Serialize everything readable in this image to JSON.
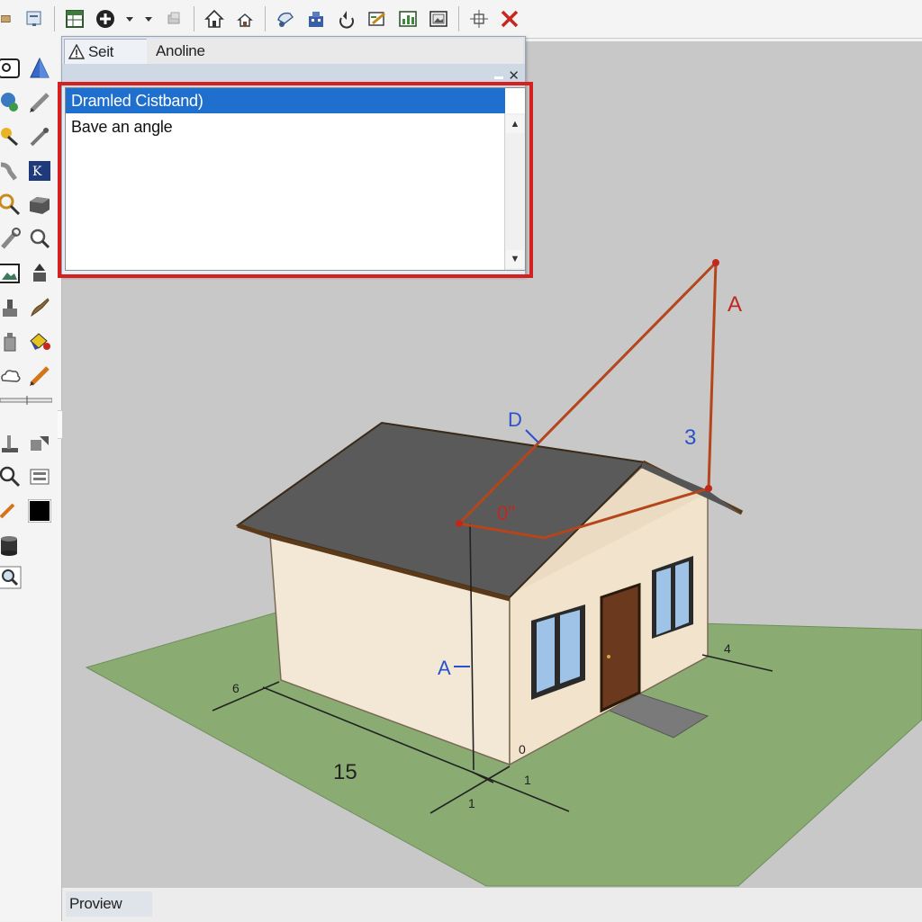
{
  "toolbar": {
    "items": [
      "save-icon",
      "document-icon",
      "table-icon",
      "add-circle-icon",
      "dropdown-arrow-icon",
      "layers-icon",
      "house-icon",
      "house-small-icon",
      "paint-icon",
      "building-icon",
      "rotate-icon",
      "edit-icon",
      "chart-icon",
      "picture-icon",
      "move-icon",
      "close-icon"
    ]
  },
  "palette": {
    "items": [
      "select-icon",
      "pyramid-icon",
      "globe-icon",
      "pencil-icon",
      "bulb-icon",
      "line-tool-icon",
      "pipe-icon",
      "text-tool-icon",
      "search-icon",
      "box-icon",
      "wrench-icon",
      "magnify-icon",
      "image-icon",
      "push-pull-icon",
      "stamp-icon",
      "brush-icon",
      "bottle-icon",
      "paint-bucket-icon",
      "cloud-icon",
      "pen-icon",
      "tape-icon",
      "tools-icon",
      "zoom-icon",
      "move-tool-icon",
      "pencil-small-icon",
      "color-swatch-icon",
      "cylinder-icon",
      "zoom-extents-icon"
    ]
  },
  "dialog": {
    "tab_active": "Seit",
    "tab_inactive": "Anoline",
    "list": {
      "selected": "Dramled Cistband)",
      "item": "Bave an angle"
    }
  },
  "scene": {
    "labels": {
      "A_top": "A",
      "D": "D",
      "three": "3",
      "angle": "0\"",
      "A_left": "A",
      "fifteen": "15",
      "six": "6",
      "four": "4",
      "one_a": "1",
      "one_b": "1",
      "zero": "0"
    },
    "colors": {
      "background": "#c8c8c8",
      "ground": "#8aac72",
      "roof": "#5a5a5a",
      "wall": "#f3e8d6",
      "guide_line": "#b5451b",
      "label_red": "#c0281e",
      "label_blue": "#2a52c9"
    }
  },
  "status": {
    "text": "Proview"
  }
}
